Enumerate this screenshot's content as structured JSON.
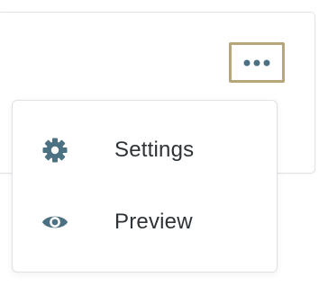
{
  "menu": {
    "items": [
      {
        "label": "Settings",
        "icon": "gear-icon"
      },
      {
        "label": "Preview",
        "icon": "eye-icon"
      }
    ]
  },
  "toolbar": {
    "more_icon": "ellipsis-icon"
  },
  "colors": {
    "icon": "#4b7182",
    "focus_outline": "#b6a67a",
    "text": "#2e3338",
    "border": "#dfe2e7"
  }
}
